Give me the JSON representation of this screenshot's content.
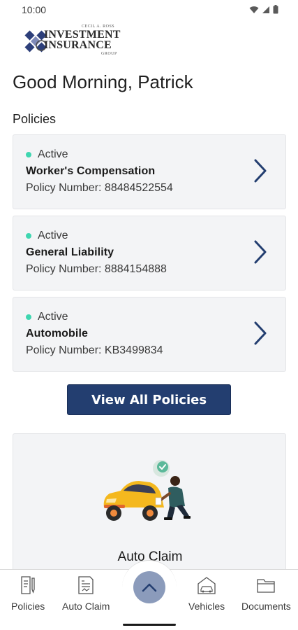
{
  "status_bar": {
    "time": "10:00"
  },
  "logo": {
    "top_text": "CECIL A. ROSS",
    "line1": "INVESTMENT",
    "line2": "INSURANCE",
    "bottom_text": "GROUP"
  },
  "greeting": "Good Morning, Patrick",
  "policies_section": {
    "title": "Policies",
    "items": [
      {
        "status": "Active",
        "name": "Worker's Compensation",
        "number": "Policy Number: 88484522554"
      },
      {
        "status": "Active",
        "name": "General Liability",
        "number": "Policy Number: 8884154888"
      },
      {
        "status": "Active",
        "name": "Automobile",
        "number": "Policy Number: KB3499834"
      }
    ],
    "view_all_label": "View All Policies"
  },
  "claim_card": {
    "label": "Auto Claim"
  },
  "bottom_nav": {
    "items": [
      {
        "label": "Policies",
        "icon": "policies-document-icon"
      },
      {
        "label": "Auto Claim",
        "icon": "auto-claim-form-icon"
      },
      {
        "label": "",
        "icon": "chevron-up-icon"
      },
      {
        "label": "Vehicles",
        "icon": "vehicle-garage-icon"
      },
      {
        "label": "Documents",
        "icon": "folder-icon"
      }
    ]
  },
  "colors": {
    "primary": "#233e70",
    "active_dot": "#3fd6b0",
    "card_bg": "#f3f4f6",
    "fab": "#8b9bbb",
    "car_yellow": "#f4b81e"
  }
}
